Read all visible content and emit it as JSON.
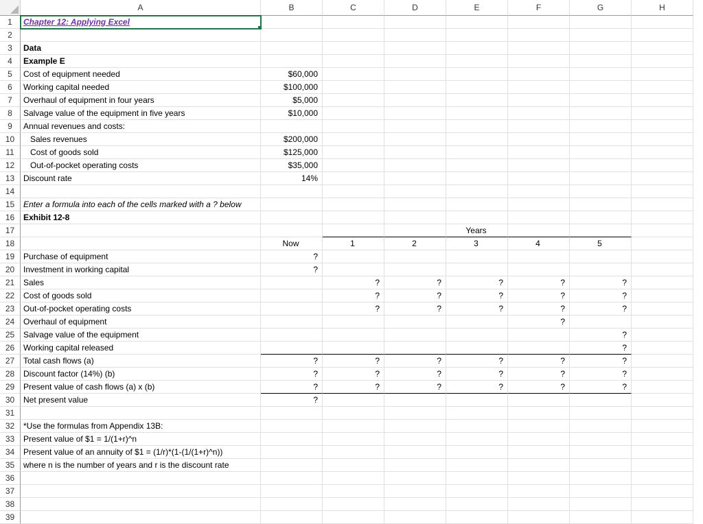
{
  "columns": [
    "A",
    "B",
    "C",
    "D",
    "E",
    "F",
    "G",
    "H"
  ],
  "row_count": 39,
  "active_cell": "A1",
  "cells": {
    "r1": {
      "A": "Chapter 12: Applying Excel"
    },
    "r3": {
      "A": "Data"
    },
    "r4": {
      "A": "Example E"
    },
    "r5": {
      "A": "Cost of equipment needed",
      "B": "$60,000"
    },
    "r6": {
      "A": "Working capital needed",
      "B": "$100,000"
    },
    "r7": {
      "A": "Overhaul of equipment in four years",
      "B": "$5,000"
    },
    "r8": {
      "A": "Salvage value of the equipment in five years",
      "B": "$10,000"
    },
    "r9": {
      "A": "Annual revenues and costs:"
    },
    "r10": {
      "A": "Sales revenues",
      "B": "$200,000"
    },
    "r11": {
      "A": "Cost of goods sold",
      "B": "$125,000"
    },
    "r12": {
      "A": "Out-of-pocket operating costs",
      "B": "$35,000"
    },
    "r13": {
      "A": "Discount rate",
      "B": "14%"
    },
    "r15": {
      "A": "Enter a formula into each of the cells marked with a ? below"
    },
    "r16": {
      "A": "Exhibit 12-8"
    },
    "r17": {
      "E": "Years"
    },
    "r18": {
      "B": "Now",
      "C": "1",
      "D": "2",
      "E": "3",
      "F": "4",
      "G": "5"
    },
    "r19": {
      "A": "Purchase of equipment",
      "B": "?"
    },
    "r20": {
      "A": "Investment in working capital",
      "B": "?"
    },
    "r21": {
      "A": "Sales",
      "C": "?",
      "D": "?",
      "E": "?",
      "F": "?",
      "G": "?"
    },
    "r22": {
      "A": "Cost of goods sold",
      "C": "?",
      "D": "?",
      "E": "?",
      "F": "?",
      "G": "?"
    },
    "r23": {
      "A": "Out-of-pocket operating costs",
      "C": "?",
      "D": "?",
      "E": "?",
      "F": "?",
      "G": "?"
    },
    "r24": {
      "A": "Overhaul of equipment",
      "F": "?"
    },
    "r25": {
      "A": "Salvage value of the equipment",
      "G": "?"
    },
    "r26": {
      "A": "Working capital released",
      "G": "?"
    },
    "r27": {
      "A": "Total cash flows (a)",
      "B": "?",
      "C": "?",
      "D": "?",
      "E": "?",
      "F": "?",
      "G": "?"
    },
    "r28": {
      "A": "Discount factor (14%) (b)",
      "B": "?",
      "C": "?",
      "D": "?",
      "E": "?",
      "F": "?",
      "G": "?"
    },
    "r29": {
      "A": "Present value of cash flows (a) x (b)",
      "B": "?",
      "C": "?",
      "D": "?",
      "E": "?",
      "F": "?",
      "G": "?"
    },
    "r30": {
      "A": "Net present value",
      "B": "?"
    },
    "r32": {
      "A": "*Use the formulas from Appendix 13B:"
    },
    "r33": {
      "A": "Present value of $1 = 1/(1+r)^n"
    },
    "r34": {
      "A": "Present value of an annuity of $1 = (1/r)*(1-(1/(1+r)^n))"
    },
    "r35": {
      "A": "where n is the number of years and r is the discount rate"
    }
  },
  "styles": {
    "bold_rows_A": [
      3,
      4,
      16
    ],
    "bold_italic_uline_purple": [
      "r1.A"
    ],
    "italic_rows_A": [
      15
    ],
    "indent_rows_A": [
      10,
      11,
      12,
      33,
      34,
      35
    ],
    "align_right_B": [
      5,
      6,
      7,
      8,
      10,
      11,
      12,
      13,
      19,
      20,
      27,
      28,
      29,
      30
    ],
    "align_right_cols_CDEFG_rows": [
      21,
      22,
      23,
      24,
      25,
      26,
      27,
      28,
      29
    ],
    "center_row18": true,
    "center_r17E": true,
    "years_underline_cols": [
      "C",
      "D",
      "E",
      "F",
      "G"
    ],
    "thick_top_row": 27,
    "thick_bottom_row29_cols": [
      "B",
      "C",
      "D",
      "E",
      "F",
      "G"
    ]
  }
}
